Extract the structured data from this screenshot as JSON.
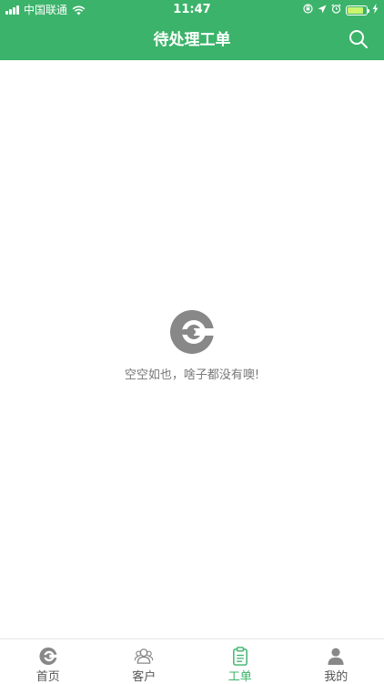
{
  "status_bar": {
    "carrier": "中国联通",
    "time": "11:47",
    "battery_level": 0.85
  },
  "header": {
    "title": "待处理工单",
    "search_icon": "search-icon"
  },
  "empty_state": {
    "icon": "app-logo-icon",
    "message": "空空如也，啥子都没有噢!"
  },
  "tabbar": {
    "items": [
      {
        "label": "首页",
        "icon": "home-logo-icon",
        "active": false
      },
      {
        "label": "客户",
        "icon": "customers-icon",
        "active": false
      },
      {
        "label": "工单",
        "icon": "clipboard-icon",
        "active": true
      },
      {
        "label": "我的",
        "icon": "profile-icon",
        "active": false
      }
    ]
  },
  "colors": {
    "accent": "#3bb36a",
    "icon_gray": "#888888",
    "battery": "#c8f56d"
  }
}
